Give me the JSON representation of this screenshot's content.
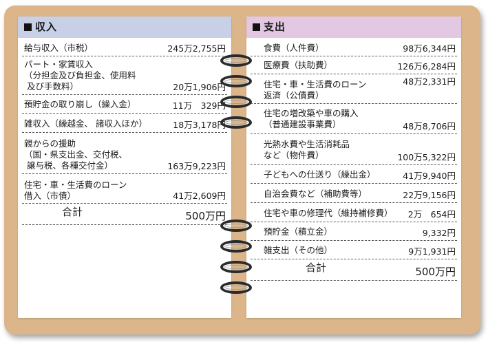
{
  "income": {
    "title": "収入",
    "rows": [
      {
        "label": "給与収入（市税）",
        "amount": "245万2,755円"
      },
      {
        "label": "パート・家賃収入\n（分担金及び負担金、使用料\n 及び手数料）",
        "amount": "20万1,906円"
      },
      {
        "label": "預貯金の取り崩し（繰入金）",
        "amount": "11万　329円"
      },
      {
        "label": "雑収入（繰越金、 諸収入ほか）",
        "amount": "18万3,178円"
      },
      {
        "label": "親からの援助\n（国・県支出金、交付税、\n 譲与税、各種交付金）",
        "amount": "163万9,223円"
      },
      {
        "label": "住宅・車・生活費のローン\n借入（市債）",
        "amount": "41万2,609円"
      }
    ],
    "total_label": "合計",
    "total_amount": "500万円"
  },
  "expense": {
    "title": "支出",
    "rows": [
      {
        "label": "食費（人件費）",
        "amount": "98万6,344円"
      },
      {
        "label": "医療費（扶助費）",
        "amount": "126万6,284円"
      },
      {
        "label": "住宅・車・生活費のローン\n返済（公債費）",
        "amount": "48万2,331円"
      },
      {
        "label": "住宅の増改築や車の購入\n（普通建設事業費）",
        "amount": "48万8,706円"
      },
      {
        "label": "光熱水費や生活消耗品\nなど（物件費）",
        "amount": "100万5,322円"
      },
      {
        "label": "子どもへの仕送り（繰出金）",
        "amount": "41万9,940円"
      },
      {
        "label": "自治会費など（補助費等）",
        "amount": "22万9,156円"
      },
      {
        "label": "住宅や車の修理代（維持補修費）",
        "amount": "2万　654円"
      },
      {
        "label": "預貯金（積立金）",
        "amount": "9,332円"
      },
      {
        "label": "雑支出（その他）",
        "amount": "9万1,931円"
      }
    ],
    "total_label": "合計",
    "total_amount": "500万円"
  }
}
